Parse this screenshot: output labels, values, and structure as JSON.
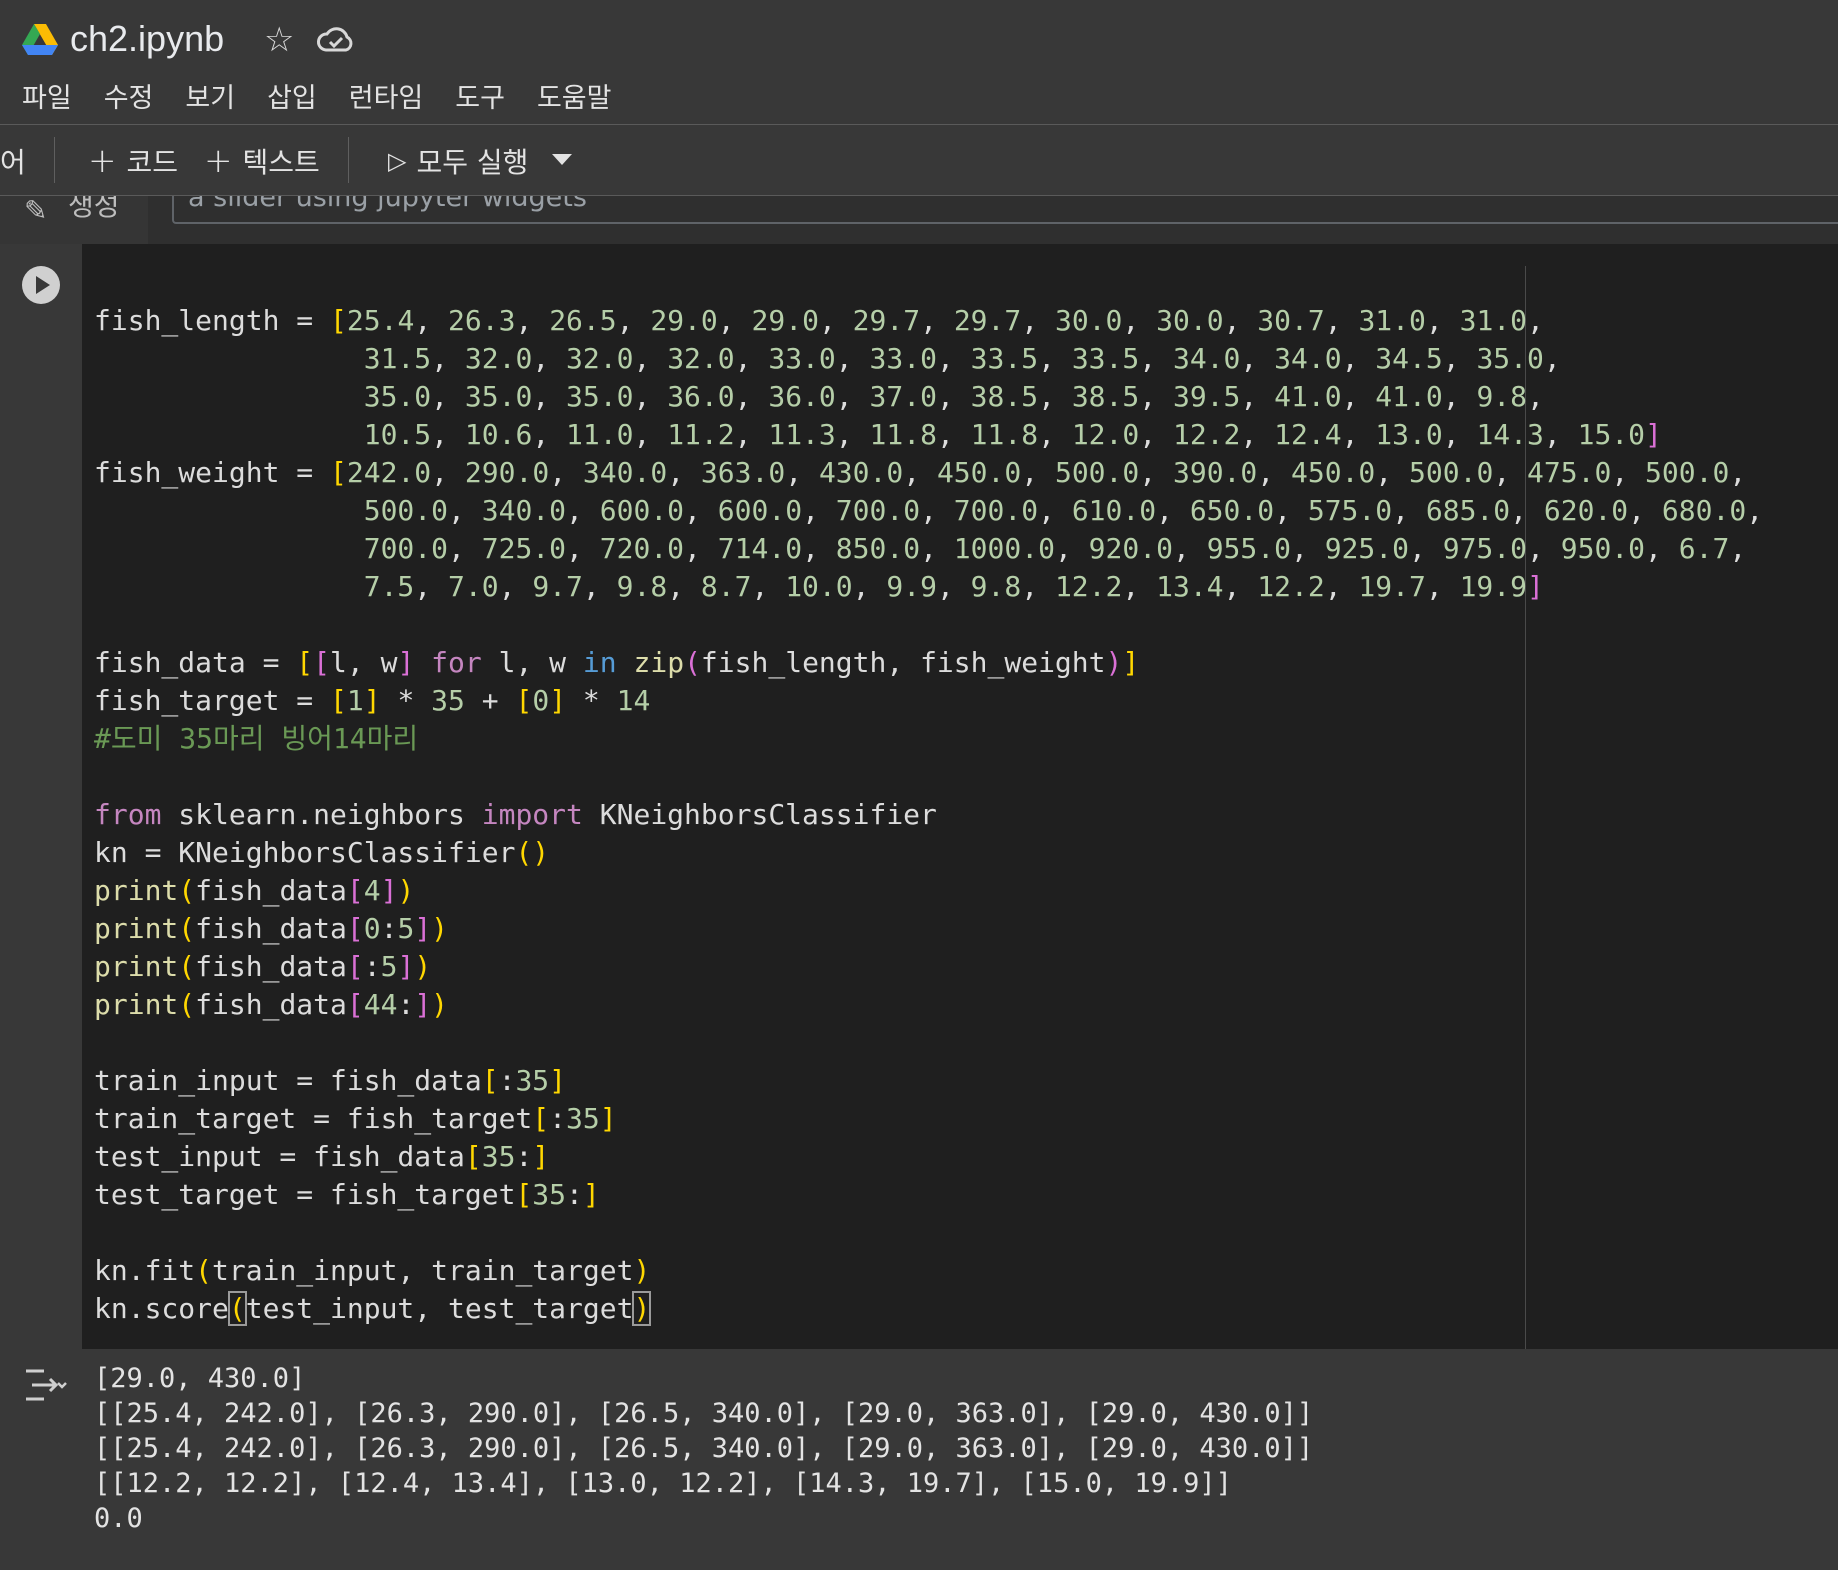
{
  "header": {
    "title": "ch2.ipynb",
    "menu": [
      "파일",
      "수정",
      "보기",
      "삽입",
      "런타임",
      "도구",
      "도움말"
    ]
  },
  "toolbar": {
    "cut_label": "어",
    "add_code": "코드",
    "add_text": "텍스트",
    "run_all": "모두 실행"
  },
  "prev_cell": {
    "label": "생성",
    "input_text": "a slider using jupyter widgets"
  },
  "code_lines": [
    "fish_length = [25.4, 26.3, 26.5, 29.0, 29.0, 29.7, 29.7, 30.0, 30.0, 30.7, 31.0, 31.0,",
    "                31.5, 32.0, 32.0, 32.0, 33.0, 33.0, 33.5, 33.5, 34.0, 34.0, 34.5, 35.0,",
    "                35.0, 35.0, 35.0, 36.0, 36.0, 37.0, 38.5, 38.5, 39.5, 41.0, 41.0, 9.8,",
    "                10.5, 10.6, 11.0, 11.2, 11.3, 11.8, 11.8, 12.0, 12.2, 12.4, 13.0, 14.3, 15.0]",
    "fish_weight = [242.0, 290.0, 340.0, 363.0, 430.0, 450.0, 500.0, 390.0, 450.0, 500.0, 475.0, 500.0,",
    "                500.0, 340.0, 600.0, 600.0, 700.0, 700.0, 610.0, 650.0, 575.0, 685.0, 620.0, 680.0,",
    "                700.0, 725.0, 720.0, 714.0, 850.0, 1000.0, 920.0, 955.0, 925.0, 975.0, 950.0, 6.7,",
    "                7.5, 7.0, 9.7, 9.8, 8.7, 10.0, 9.9, 9.8, 12.2, 13.4, 12.2, 19.7, 19.9]",
    "",
    "fish_data = [[l, w] for l, w in zip(fish_length, fish_weight)]",
    "fish_target = [1] * 35 + [0] * 14",
    "#도미 35마리 빙어14마리",
    "",
    "from sklearn.neighbors import KNeighborsClassifier",
    "kn = KNeighborsClassifier()",
    "print(fish_data[4])",
    "print(fish_data[0:5])",
    "print(fish_data[:5])",
    "print(fish_data[44:])",
    "",
    "train_input = fish_data[:35]",
    "train_target = fish_target[:35]",
    "test_input = fish_data[35:]",
    "test_target = fish_target[35:]",
    "",
    "kn.fit(train_input, train_target)",
    "kn.score(test_input, test_target)"
  ],
  "output_lines": [
    "[29.0, 430.0]",
    "[[25.4, 242.0], [26.3, 290.0], [26.5, 340.0], [29.0, 363.0], [29.0, 430.0]]",
    "[[25.4, 242.0], [26.3, 290.0], [26.5, 340.0], [29.0, 363.0], [29.0, 430.0]]",
    "[[12.2, 12.2], [12.4, 13.4], [13.0, 12.2], [14.3, 19.7], [15.0, 19.9]]",
    "0.0"
  ]
}
